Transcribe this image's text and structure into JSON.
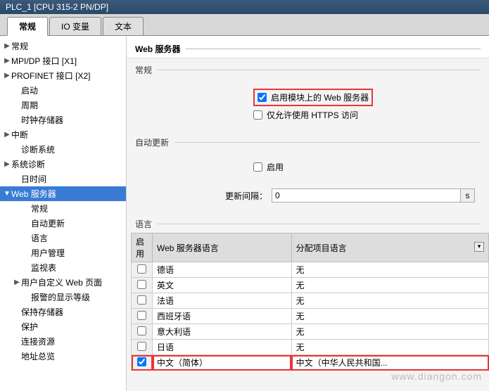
{
  "title": "PLC_1 [CPU 315-2 PN/DP]",
  "tabs": {
    "general": "常规",
    "iovars": "IO 变量",
    "text": "文本"
  },
  "tree": {
    "general": "常规",
    "mpidp": "MPI/DP 接口 [X1]",
    "profinet": "PROFINET 接口 [X2]",
    "startup": "启动",
    "cycle": "周期",
    "clockmem": "时钟存储器",
    "interrupt": "中断",
    "diagsys": "诊断系统",
    "sysdiag": "系统诊断",
    "datetime": "日时间",
    "webserver": "Web 服务器",
    "ws_general": "常规",
    "ws_autoupd": "自动更新",
    "ws_lang": "语言",
    "ws_usermgmt": "用户管理",
    "ws_watch": "监视表",
    "ws_userpages": "用户自定义 Web 页面",
    "ws_alarmlvl": "报警的显示等级",
    "retmem": "保持存储器",
    "protect": "保护",
    "connres": "连接资源",
    "addrsum": "地址总览"
  },
  "main": {
    "header": "Web 服务器",
    "sec_general": "常规",
    "ck_enable_web": "启用模块上的 Web 服务器",
    "ck_https_only": "仅允许使用 HTTPS 访问",
    "sec_autoupd": "自动更新",
    "ck_enable": "启用",
    "interval_label": "更新间隔：",
    "interval_value": "0",
    "interval_unit": "s",
    "sec_lang": "语言",
    "tbl": {
      "col_enable": "启用",
      "col_wslang": "Web 服务器语言",
      "col_projlang": "分配项目语言",
      "rows": [
        {
          "ws": "德语",
          "proj": "无",
          "ck": false
        },
        {
          "ws": "英文",
          "proj": "无",
          "ck": false
        },
        {
          "ws": "法语",
          "proj": "无",
          "ck": false
        },
        {
          "ws": "西班牙语",
          "proj": "无",
          "ck": false
        },
        {
          "ws": "意大利语",
          "proj": "无",
          "ck": false
        },
        {
          "ws": "日语",
          "proj": "无",
          "ck": false
        },
        {
          "ws": "中文（简体）",
          "proj": "中文（中华人民共和国...",
          "ck": true
        }
      ]
    }
  },
  "watermark": "www.diangon.com"
}
